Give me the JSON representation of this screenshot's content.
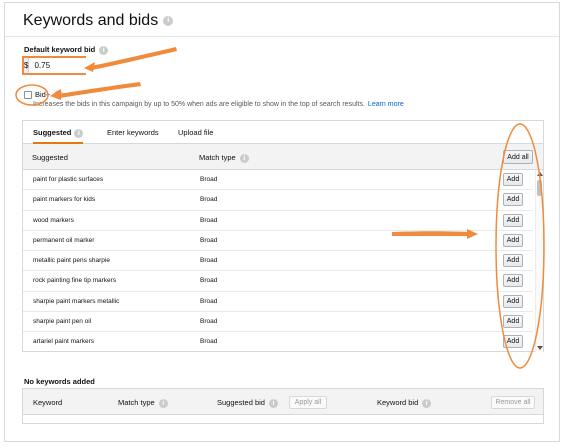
{
  "section": {
    "title": "Keywords and bids"
  },
  "default_bid": {
    "label": "Default keyword bid",
    "currency": "$",
    "value": "0.75"
  },
  "bid_plus": {
    "label": "Bid+",
    "description": "Increases the bids in this campaign by up to 50% when ads are eligible to show in the top of search results.",
    "link": "Learn more"
  },
  "tabs": [
    {
      "label": "Suggested"
    },
    {
      "label": "Enter keywords"
    },
    {
      "label": "Upload file"
    }
  ],
  "suggested_table": {
    "col_keyword": "Suggested",
    "col_match": "Match type",
    "add_all_label": "Add all",
    "add_label": "Add",
    "rows": [
      {
        "keyword": "paint for plastic surfaces",
        "match": "Broad"
      },
      {
        "keyword": "paint markers for kids",
        "match": "Broad"
      },
      {
        "keyword": "wood markers",
        "match": "Broad"
      },
      {
        "keyword": "permanent oil marker",
        "match": "Broad"
      },
      {
        "keyword": "metallic paint pens sharpie",
        "match": "Broad"
      },
      {
        "keyword": "rock painting fine tip markers",
        "match": "Broad"
      },
      {
        "keyword": "sharpie paint markers metallic",
        "match": "Broad"
      },
      {
        "keyword": "sharpie paint pen oil",
        "match": "Broad"
      },
      {
        "keyword": "artariel paint markers",
        "match": "Broad"
      }
    ]
  },
  "added_table": {
    "heading": "No keywords added",
    "col_keyword": "Keyword",
    "col_match": "Match type",
    "col_suggested_bid": "Suggested bid",
    "apply_all_label": "Apply all",
    "col_keyword_bid": "Keyword bid",
    "remove_all_label": "Remove all"
  },
  "annotation_color": "#f08a3c"
}
